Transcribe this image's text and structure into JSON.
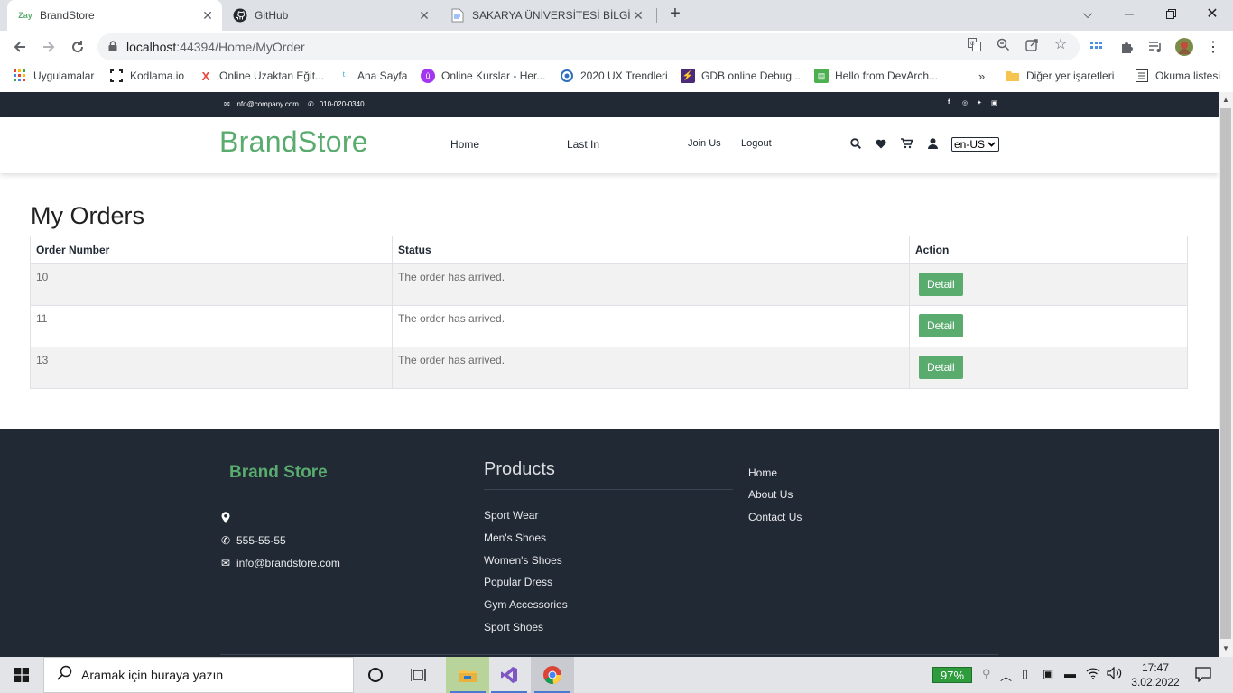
{
  "browser": {
    "tabs": [
      {
        "favicon": "Zay",
        "title": "BrandStore",
        "active": true
      },
      {
        "favicon": "github-icon",
        "title": "GitHub",
        "active": false
      },
      {
        "favicon": "document-icon",
        "title": "SAKARYA ÜNİVERSİTESİ BİLGİ SİS",
        "active": false
      }
    ],
    "new_tab": "+",
    "url_host": "localhost",
    "url_path": ":44394/Home/MyOrder",
    "bookmarks": [
      "Uygulamalar",
      "Kodlama.io",
      "Online Uzaktan Eğit...",
      "Ana Sayfa",
      "Online Kurslar - Her...",
      "2020 UX Trendleri",
      "GDB online Debug...",
      "Hello from DevArch..."
    ],
    "bookmarks_overflow": "»",
    "other_bookmarks": "Diğer yer işaretleri",
    "reading_list": "Okuma listesi"
  },
  "site": {
    "topbar": {
      "email": "info@company.com",
      "phone": "010-020-0340"
    },
    "brand": "BrandStore",
    "nav": {
      "home": "Home",
      "last_in": "Last In",
      "join": "Join Us",
      "logout": "Logout"
    },
    "language": "en-US"
  },
  "orders": {
    "title": "My Orders",
    "columns": [
      "Order Number",
      "Status",
      "Action"
    ],
    "rows": [
      {
        "number": "10",
        "status": "The order has arrived.",
        "action": "Detail"
      },
      {
        "number": "11",
        "status": "The order has arrived.",
        "action": "Detail"
      },
      {
        "number": "13",
        "status": "The order has arrived.",
        "action": "Detail"
      }
    ]
  },
  "footer": {
    "brand": "Brand Store",
    "phone": "555-55-55",
    "email": "info@brandstore.com",
    "products_heading": "Products",
    "products": [
      "Sport Wear",
      "Men's Shoes",
      "Women's Shoes",
      "Popular Dress",
      "Gym Accessories",
      "Sport Shoes"
    ],
    "links": [
      "Home",
      "About Us",
      "Contact Us"
    ]
  },
  "taskbar": {
    "search_placeholder": "Aramak için buraya yazın",
    "battery": "97%",
    "time": "17:47",
    "date": "3.02.2022"
  },
  "colors": {
    "brand_green": "#59ab6e",
    "dark": "#212934"
  }
}
